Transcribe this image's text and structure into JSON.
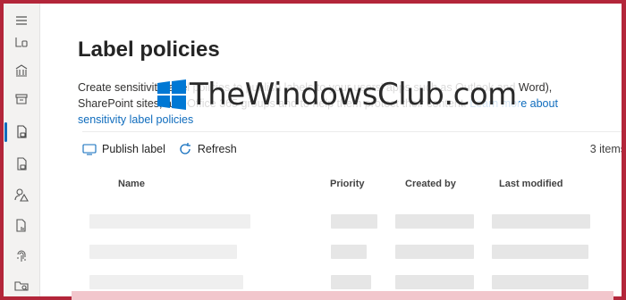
{
  "page": {
    "title": "Label policies",
    "description": "Create sensitivity label policies to publish labels to your users' apps such as Outlook and Word), SharePoint sites, and Office 365 groups and to help them protect their content.",
    "learn_more_link": "Learn more about sensitivity label policies"
  },
  "watermark": {
    "text": "TheWindowsClub.com"
  },
  "toolbar": {
    "publish_label": "Publish label",
    "refresh_label": "Refresh",
    "item_count": "3 items"
  },
  "table": {
    "columns": [
      "Name",
      "Priority",
      "Created by",
      "Last modified"
    ]
  },
  "rail": {
    "items": [
      "menu-icon",
      "label-icon",
      "bank-icon",
      "archive-icon",
      "label-policy-icon",
      "document-lock-icon",
      "person-warning-icon",
      "document-chart-icon",
      "fingerprint-icon",
      "folder-search-icon"
    ],
    "active_index": 4
  },
  "colors": {
    "accent": "#0f6cbd",
    "frame": "#b3263a"
  }
}
